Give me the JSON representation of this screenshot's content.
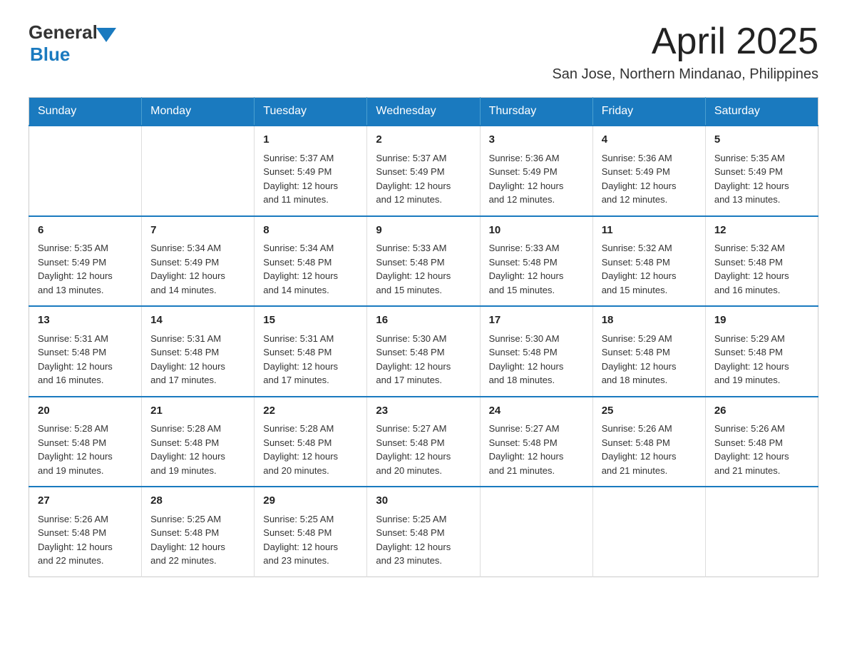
{
  "logo": {
    "general": "General",
    "blue": "Blue",
    "arrow_color": "#1a7abf"
  },
  "title": {
    "month_year": "April 2025",
    "location": "San Jose, Northern Mindanao, Philippines"
  },
  "header_days": [
    "Sunday",
    "Monday",
    "Tuesday",
    "Wednesday",
    "Thursday",
    "Friday",
    "Saturday"
  ],
  "weeks": [
    [
      {
        "day": "",
        "info": ""
      },
      {
        "day": "",
        "info": ""
      },
      {
        "day": "1",
        "info": "Sunrise: 5:37 AM\nSunset: 5:49 PM\nDaylight: 12 hours\nand 11 minutes."
      },
      {
        "day": "2",
        "info": "Sunrise: 5:37 AM\nSunset: 5:49 PM\nDaylight: 12 hours\nand 12 minutes."
      },
      {
        "day": "3",
        "info": "Sunrise: 5:36 AM\nSunset: 5:49 PM\nDaylight: 12 hours\nand 12 minutes."
      },
      {
        "day": "4",
        "info": "Sunrise: 5:36 AM\nSunset: 5:49 PM\nDaylight: 12 hours\nand 12 minutes."
      },
      {
        "day": "5",
        "info": "Sunrise: 5:35 AM\nSunset: 5:49 PM\nDaylight: 12 hours\nand 13 minutes."
      }
    ],
    [
      {
        "day": "6",
        "info": "Sunrise: 5:35 AM\nSunset: 5:49 PM\nDaylight: 12 hours\nand 13 minutes."
      },
      {
        "day": "7",
        "info": "Sunrise: 5:34 AM\nSunset: 5:49 PM\nDaylight: 12 hours\nand 14 minutes."
      },
      {
        "day": "8",
        "info": "Sunrise: 5:34 AM\nSunset: 5:48 PM\nDaylight: 12 hours\nand 14 minutes."
      },
      {
        "day": "9",
        "info": "Sunrise: 5:33 AM\nSunset: 5:48 PM\nDaylight: 12 hours\nand 15 minutes."
      },
      {
        "day": "10",
        "info": "Sunrise: 5:33 AM\nSunset: 5:48 PM\nDaylight: 12 hours\nand 15 minutes."
      },
      {
        "day": "11",
        "info": "Sunrise: 5:32 AM\nSunset: 5:48 PM\nDaylight: 12 hours\nand 15 minutes."
      },
      {
        "day": "12",
        "info": "Sunrise: 5:32 AM\nSunset: 5:48 PM\nDaylight: 12 hours\nand 16 minutes."
      }
    ],
    [
      {
        "day": "13",
        "info": "Sunrise: 5:31 AM\nSunset: 5:48 PM\nDaylight: 12 hours\nand 16 minutes."
      },
      {
        "day": "14",
        "info": "Sunrise: 5:31 AM\nSunset: 5:48 PM\nDaylight: 12 hours\nand 17 minutes."
      },
      {
        "day": "15",
        "info": "Sunrise: 5:31 AM\nSunset: 5:48 PM\nDaylight: 12 hours\nand 17 minutes."
      },
      {
        "day": "16",
        "info": "Sunrise: 5:30 AM\nSunset: 5:48 PM\nDaylight: 12 hours\nand 17 minutes."
      },
      {
        "day": "17",
        "info": "Sunrise: 5:30 AM\nSunset: 5:48 PM\nDaylight: 12 hours\nand 18 minutes."
      },
      {
        "day": "18",
        "info": "Sunrise: 5:29 AM\nSunset: 5:48 PM\nDaylight: 12 hours\nand 18 minutes."
      },
      {
        "day": "19",
        "info": "Sunrise: 5:29 AM\nSunset: 5:48 PM\nDaylight: 12 hours\nand 19 minutes."
      }
    ],
    [
      {
        "day": "20",
        "info": "Sunrise: 5:28 AM\nSunset: 5:48 PM\nDaylight: 12 hours\nand 19 minutes."
      },
      {
        "day": "21",
        "info": "Sunrise: 5:28 AM\nSunset: 5:48 PM\nDaylight: 12 hours\nand 19 minutes."
      },
      {
        "day": "22",
        "info": "Sunrise: 5:28 AM\nSunset: 5:48 PM\nDaylight: 12 hours\nand 20 minutes."
      },
      {
        "day": "23",
        "info": "Sunrise: 5:27 AM\nSunset: 5:48 PM\nDaylight: 12 hours\nand 20 minutes."
      },
      {
        "day": "24",
        "info": "Sunrise: 5:27 AM\nSunset: 5:48 PM\nDaylight: 12 hours\nand 21 minutes."
      },
      {
        "day": "25",
        "info": "Sunrise: 5:26 AM\nSunset: 5:48 PM\nDaylight: 12 hours\nand 21 minutes."
      },
      {
        "day": "26",
        "info": "Sunrise: 5:26 AM\nSunset: 5:48 PM\nDaylight: 12 hours\nand 21 minutes."
      }
    ],
    [
      {
        "day": "27",
        "info": "Sunrise: 5:26 AM\nSunset: 5:48 PM\nDaylight: 12 hours\nand 22 minutes."
      },
      {
        "day": "28",
        "info": "Sunrise: 5:25 AM\nSunset: 5:48 PM\nDaylight: 12 hours\nand 22 minutes."
      },
      {
        "day": "29",
        "info": "Sunrise: 5:25 AM\nSunset: 5:48 PM\nDaylight: 12 hours\nand 23 minutes."
      },
      {
        "day": "30",
        "info": "Sunrise: 5:25 AM\nSunset: 5:48 PM\nDaylight: 12 hours\nand 23 minutes."
      },
      {
        "day": "",
        "info": ""
      },
      {
        "day": "",
        "info": ""
      },
      {
        "day": "",
        "info": ""
      }
    ]
  ]
}
